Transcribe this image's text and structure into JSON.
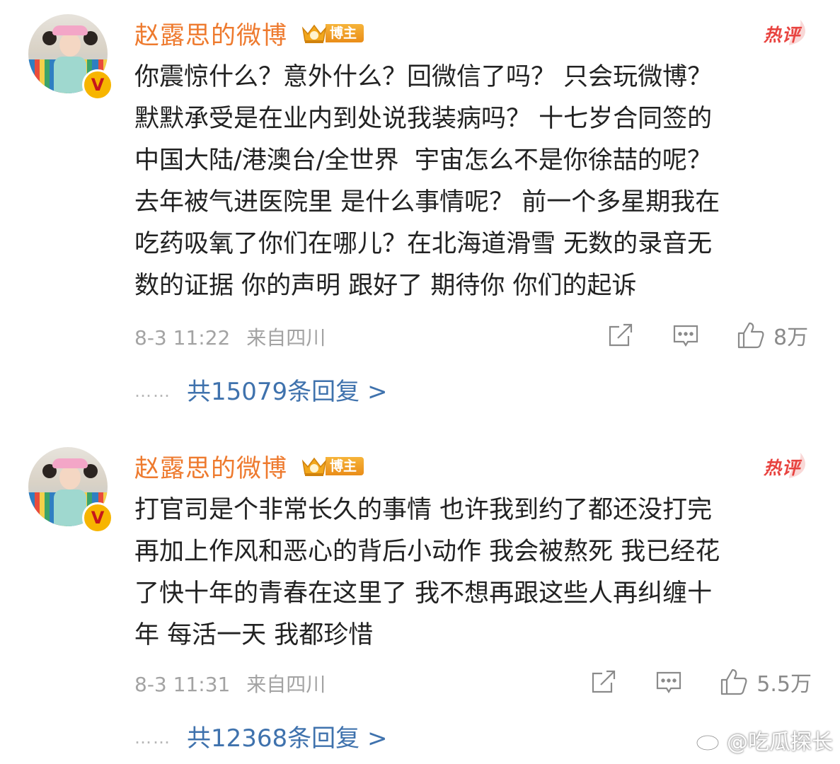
{
  "comments": [
    {
      "username": "赵露思的微博",
      "badge_label": "博主",
      "hot_label": "热评",
      "content": "你震惊什么？意外什么？回微信了吗？ 只会玩微博？\n默默承受是在业内到处说我装病吗？ 十七岁合同签的\n中国大陆/港澳台/全世界  宇宙怎么不是你徐喆的呢？\n去年被气进医院里 是什么事情呢？ 前一个多星期我在\n吃药吸氧了你们在哪儿？在北海道滑雪 无数的录音无\n数的证据 你的声明 跟好了 期待你 你们的起诉",
      "time": "8-3 11:22",
      "source": "来自四川",
      "like_count": "8万",
      "replies_text": "共15079条回复 >"
    },
    {
      "username": "赵露思的微博",
      "badge_label": "博主",
      "hot_label": "热评",
      "content": "打官司是个非常长久的事情 也许我到约了都还没打完\n再加上作风和恶心的背后小动作 我会被熬死 我已经花\n了快十年的青春在这里了 我不想再跟这些人再纠缠十\n年 每活一天 我都珍惜",
      "time": "8-3 11:31",
      "source": "来自四川",
      "like_count": "5.5万",
      "replies_text": "共12368条回复 >"
    }
  ],
  "watermark": "@吃瓜探长",
  "colors": {
    "username": "#ee7a2e",
    "hot": "#e8433f",
    "link": "#3f72ad",
    "meta": "#a3a3a3",
    "badge": "#ea8d18"
  },
  "icons": [
    "verified-v-icon",
    "crown-badge-icon",
    "share-icon",
    "comment-icon",
    "like-icon",
    "weibo-logo-icon"
  ]
}
